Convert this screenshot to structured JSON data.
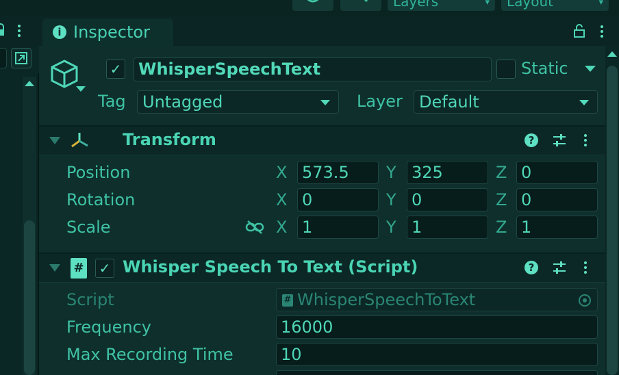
{
  "inspector": {
    "tab_label": "Inspector",
    "info_icon": "info-icon",
    "lock_icon": "lock-icon",
    "menu_icon": "kebab-menu-icon"
  },
  "toolbar": {
    "layers_label": "Layers",
    "layout_label": "Layout"
  },
  "gameobject": {
    "active_checked": true,
    "name": "WhisperSpeechText",
    "static_label": "Static",
    "static_checked": false,
    "tag_label": "Tag",
    "tag_value": "Untagged",
    "layer_label": "Layer",
    "layer_value": "Default"
  },
  "transform": {
    "title": "Transform",
    "position_label": "Position",
    "rotation_label": "Rotation",
    "scale_label": "Scale",
    "position": {
      "x": "573.5",
      "y": "325",
      "z": "0"
    },
    "rotation": {
      "x": "0",
      "y": "0",
      "z": "0"
    },
    "scale": {
      "x": "1",
      "y": "1",
      "z": "1"
    },
    "axis_x": "X",
    "axis_y": "Y",
    "axis_z": "Z"
  },
  "script_component": {
    "title": "Whisper Speech To Text (Script)",
    "enabled_checked": true,
    "script_label": "Script",
    "script_value": "WhisperSpeechToText",
    "frequency_label": "Frequency",
    "frequency_value": "16000",
    "max_recording_label": "Max Recording Time",
    "max_recording_value": "10"
  },
  "colors": {
    "accent": "#46cfb0",
    "background": "#0e2f2c",
    "field_bg": "#071d1b"
  }
}
